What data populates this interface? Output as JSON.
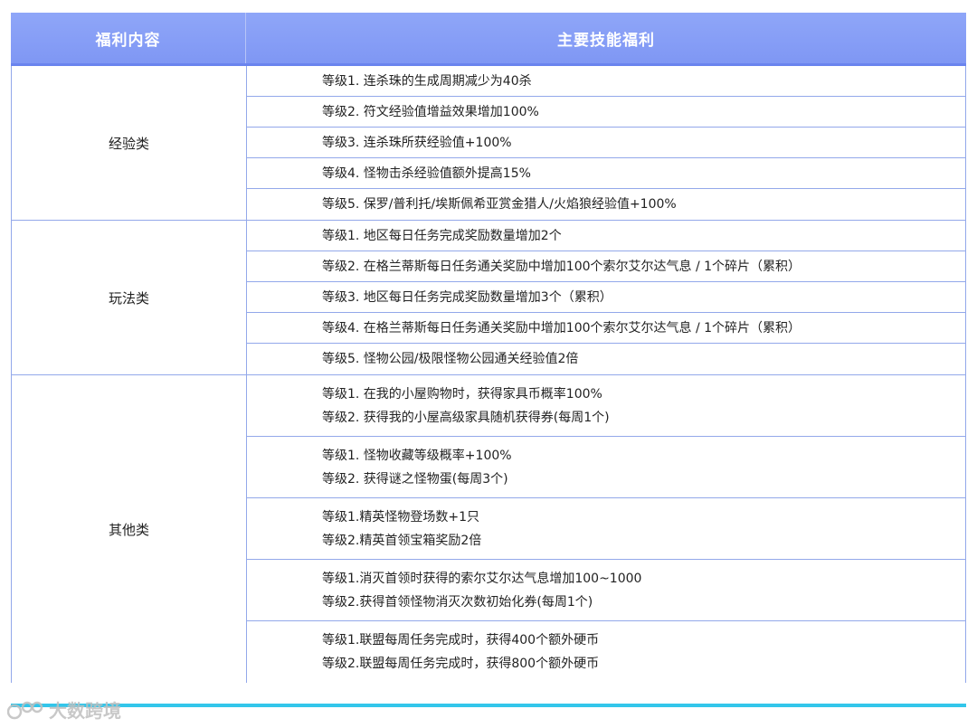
{
  "header": {
    "col1": "福利内容",
    "col2": "主要技能福利"
  },
  "groups": [
    {
      "category": "经验类",
      "rows": [
        [
          "等级1. 连杀珠的生成周期减少为40杀"
        ],
        [
          "等级2. 符文经验值增益效果增加100%"
        ],
        [
          "等级3. 连杀珠所获经验值+100%"
        ],
        [
          "等级4. 怪物击杀经验值额外提高15%"
        ],
        [
          "等级5. 保罗/普利托/埃斯佩希亚赏金猎人/火焰狼经验值+100%"
        ]
      ]
    },
    {
      "category": "玩法类",
      "rows": [
        [
          "等级1. 地区每日任务完成奖励数量增加2个"
        ],
        [
          "等级2. 在格兰蒂斯每日任务通关奖励中增加100个索尔艾尔达气息 / 1个碎片（累积）"
        ],
        [
          "等级3. 地区每日任务完成奖励数量增加3个（累积）"
        ],
        [
          "等级4. 在格兰蒂斯每日任务通关奖励中增加100个索尔艾尔达气息 / 1个碎片（累积）"
        ],
        [
          "等级5. 怪物公园/极限怪物公园通关经验值2倍"
        ]
      ]
    },
    {
      "category": "其他类",
      "rows": [
        [
          "等级1. 在我的小屋购物时，获得家具币概率100%",
          "等级2. 获得我的小屋高级家具随机获得券(每周1个)"
        ],
        [
          "等级1. 怪物收藏等级概率+100%",
          "等级2. 获得谜之怪物蛋(每周3个)"
        ],
        [
          "等级1.精英怪物登场数+1只",
          "等级2.精英首领宝箱奖励2倍"
        ],
        [
          "等级1.消灭首领时获得的索尔艾尔达气息增加100~1000",
          "等级2.获得首领怪物消灭次数初始化券(每周1个)"
        ],
        [
          "等级1.联盟每周任务完成时，获得400个额外硬币",
          "等级2.联盟每周任务完成时，获得800个额外硬币"
        ]
      ]
    }
  ],
  "watermark": "大数跨境"
}
